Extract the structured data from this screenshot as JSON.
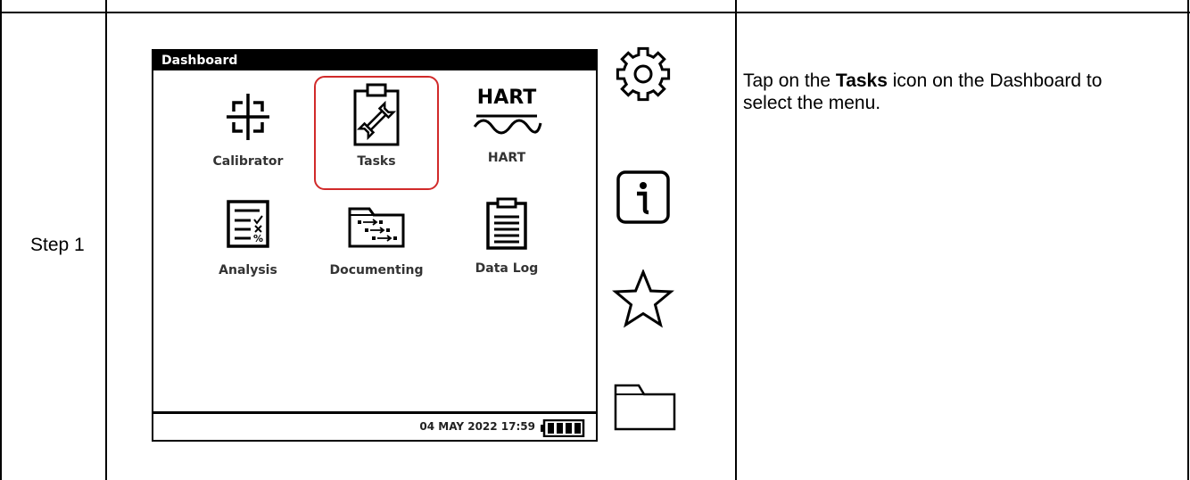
{
  "step": {
    "label": "Step 1"
  },
  "instruction": {
    "prefix": "Tap on the ",
    "bold": "Tasks",
    "suffix": " icon on the Dashboard to select the menu."
  },
  "dashboard": {
    "title": "Dashboard",
    "apps": [
      {
        "label": "Calibrator",
        "icon": "crosshair-icon"
      },
      {
        "label": "Tasks",
        "icon": "clipboard-wrench-icon",
        "highlighted": true
      },
      {
        "label": "HART",
        "icon": "hart-wave-icon",
        "icon_text": "HART"
      },
      {
        "label": "Analysis",
        "icon": "checklist-icon"
      },
      {
        "label": "Documenting",
        "icon": "folder-flow-icon"
      },
      {
        "label": "Data Log",
        "icon": "clipboard-list-icon"
      }
    ],
    "status": {
      "datetime": "04 MAY 2022 17:59",
      "battery_level": 1.0
    }
  },
  "side_icons": [
    "gear-icon",
    "info-icon",
    "star-icon",
    "folder-icon"
  ],
  "colors": {
    "highlight": "#d12a2a",
    "header_bg": "#000000",
    "header_fg": "#ffffff"
  }
}
